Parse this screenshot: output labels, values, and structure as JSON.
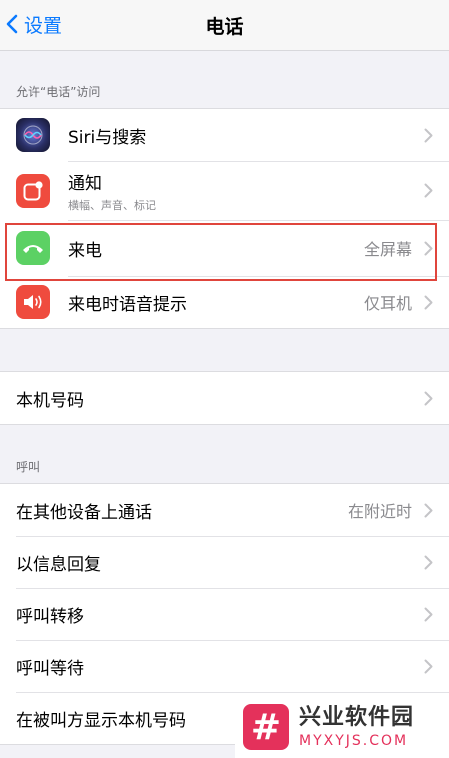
{
  "nav": {
    "back_label": "设置",
    "title": "电话"
  },
  "section_allow": {
    "header": "允许“电话”访问",
    "items": [
      {
        "title": "Siri与搜索",
        "icon": "siri-icon"
      },
      {
        "title": "通知",
        "subtitle": "横幅、声音、标记",
        "icon": "notification-icon"
      },
      {
        "title": "来电",
        "value": "全屏幕",
        "icon": "phone-call-icon"
      },
      {
        "title": "来电时语音提示",
        "value": "仅耳机",
        "icon": "speaker-icon"
      }
    ]
  },
  "my_number": {
    "title": "本机号码"
  },
  "section_calls": {
    "header": "呼叫",
    "items": [
      {
        "title": "在其他设备上通话",
        "value": "在附近时"
      },
      {
        "title": "以信息回复"
      },
      {
        "title": "呼叫转移"
      },
      {
        "title": "呼叫等待"
      },
      {
        "title": "在被叫方显示本机号码"
      }
    ]
  },
  "watermark": {
    "title": "兴业软件园",
    "url": "MYXYJS.COM"
  },
  "colors": {
    "accent": "#0a7aff",
    "highlight": "#e0453c",
    "watermark": "#e4315b"
  }
}
